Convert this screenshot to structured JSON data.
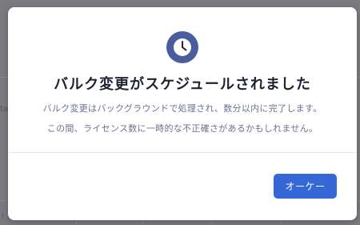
{
  "background": {
    "fragment_left": "ta",
    "fragment_bottom": "l"
  },
  "dialog": {
    "icon": "clock-icon",
    "title": "バルク変更がスケジュールされました",
    "description_line1": "バルク変更はバックグラウンドで処理され、数分以内に完了します。",
    "description_line2": "この間、ライセンス数に一時的な不正確さがあるかもしれません。",
    "ok_label": "オーケー"
  },
  "colors": {
    "accent": "#3567d6",
    "icon_badge": "#4a5e9e",
    "overlay": "#7b7b7f"
  }
}
